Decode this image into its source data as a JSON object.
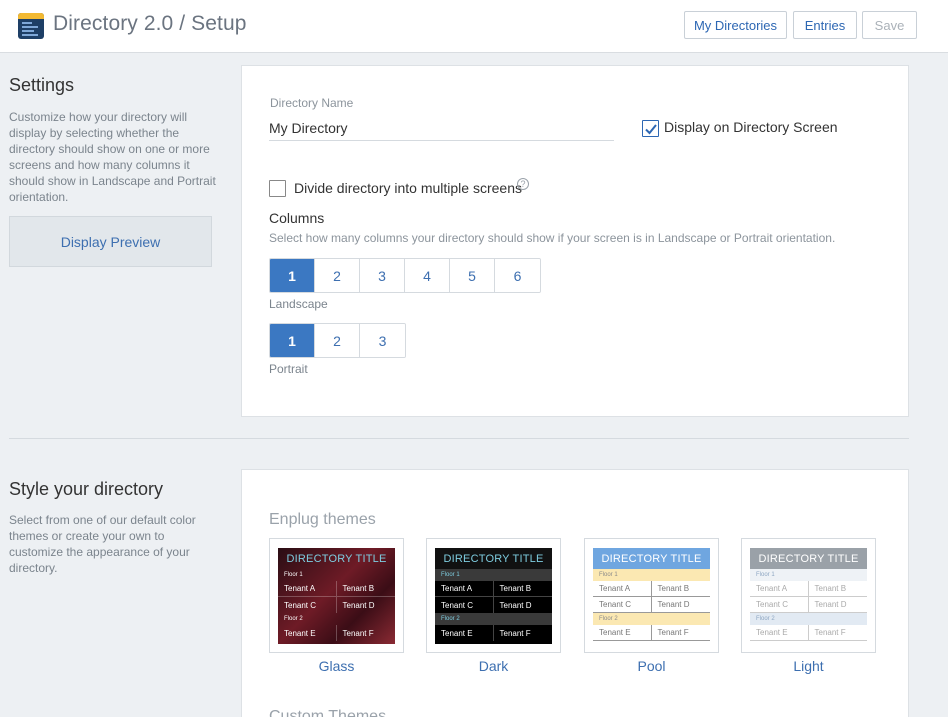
{
  "header": {
    "title": "Directory 2.0 / Setup",
    "buttons": {
      "my_directories": "My Directories",
      "entries": "Entries",
      "save": "Save"
    }
  },
  "settings": {
    "title": "Settings",
    "description": "Customize how your directory will display by selecting whether the directory should show on one or more screens and how many columns it should show in Landscape and Portrait orientation.",
    "preview_button": "Display Preview",
    "directory_name_label": "Directory Name",
    "directory_name_value": "My Directory",
    "display_on_screen_label": "Display on Directory Screen",
    "display_on_screen_checked": true,
    "divide_label": "Divide directory into multiple screens",
    "divide_checked": false,
    "help_icon": "question-circle-icon",
    "columns_title": "Columns",
    "columns_desc": "Select how many columns your directory should show if your screen is in Landscape or Portrait orientation.",
    "landscape_options": [
      "1",
      "2",
      "3",
      "4",
      "5",
      "6"
    ],
    "landscape_selected": "1",
    "landscape_label": "Landscape",
    "portrait_options": [
      "1",
      "2",
      "3"
    ],
    "portrait_selected": "1",
    "portrait_label": "Portrait"
  },
  "style": {
    "title": "Style your directory",
    "description": "Select from one of our default color themes or create your own to customize the appearance of your directory.",
    "themes_title": "Enplug themes",
    "themes": [
      {
        "name": "Glass",
        "preview_title": "DIRECTORY TITLE",
        "floor1": "Floor 1",
        "floor2": "Floor 2",
        "tenants": [
          "Tenant A",
          "Tenant B",
          "Tenant C",
          "Tenant D",
          "Tenant E",
          "Tenant F"
        ]
      },
      {
        "name": "Dark",
        "preview_title": "DIRECTORY TITLE",
        "floor1": "Floor 1",
        "floor2": "Floor 2",
        "tenants": [
          "Tenant A",
          "Tenant B",
          "Tenant C",
          "Tenant D",
          "Tenant E",
          "Tenant F"
        ]
      },
      {
        "name": "Pool",
        "preview_title": "DIRECTORY TITLE",
        "floor1": "Floor 1",
        "floor2": "Floor 2",
        "tenants": [
          "Tenant A",
          "Tenant B",
          "Tenant C",
          "Tenant D",
          "Tenant E",
          "Tenant F"
        ]
      },
      {
        "name": "Light",
        "preview_title": "DIRECTORY TITLE",
        "floor1": "Floor 1",
        "floor2": "Floor 2",
        "tenants": [
          "Tenant A",
          "Tenant B",
          "Tenant C",
          "Tenant D",
          "Tenant E",
          "Tenant F"
        ]
      }
    ],
    "custom_themes_title": "Custom Themes"
  },
  "colors": {
    "accent": "#3b78c2",
    "link": "#2d67b3"
  }
}
